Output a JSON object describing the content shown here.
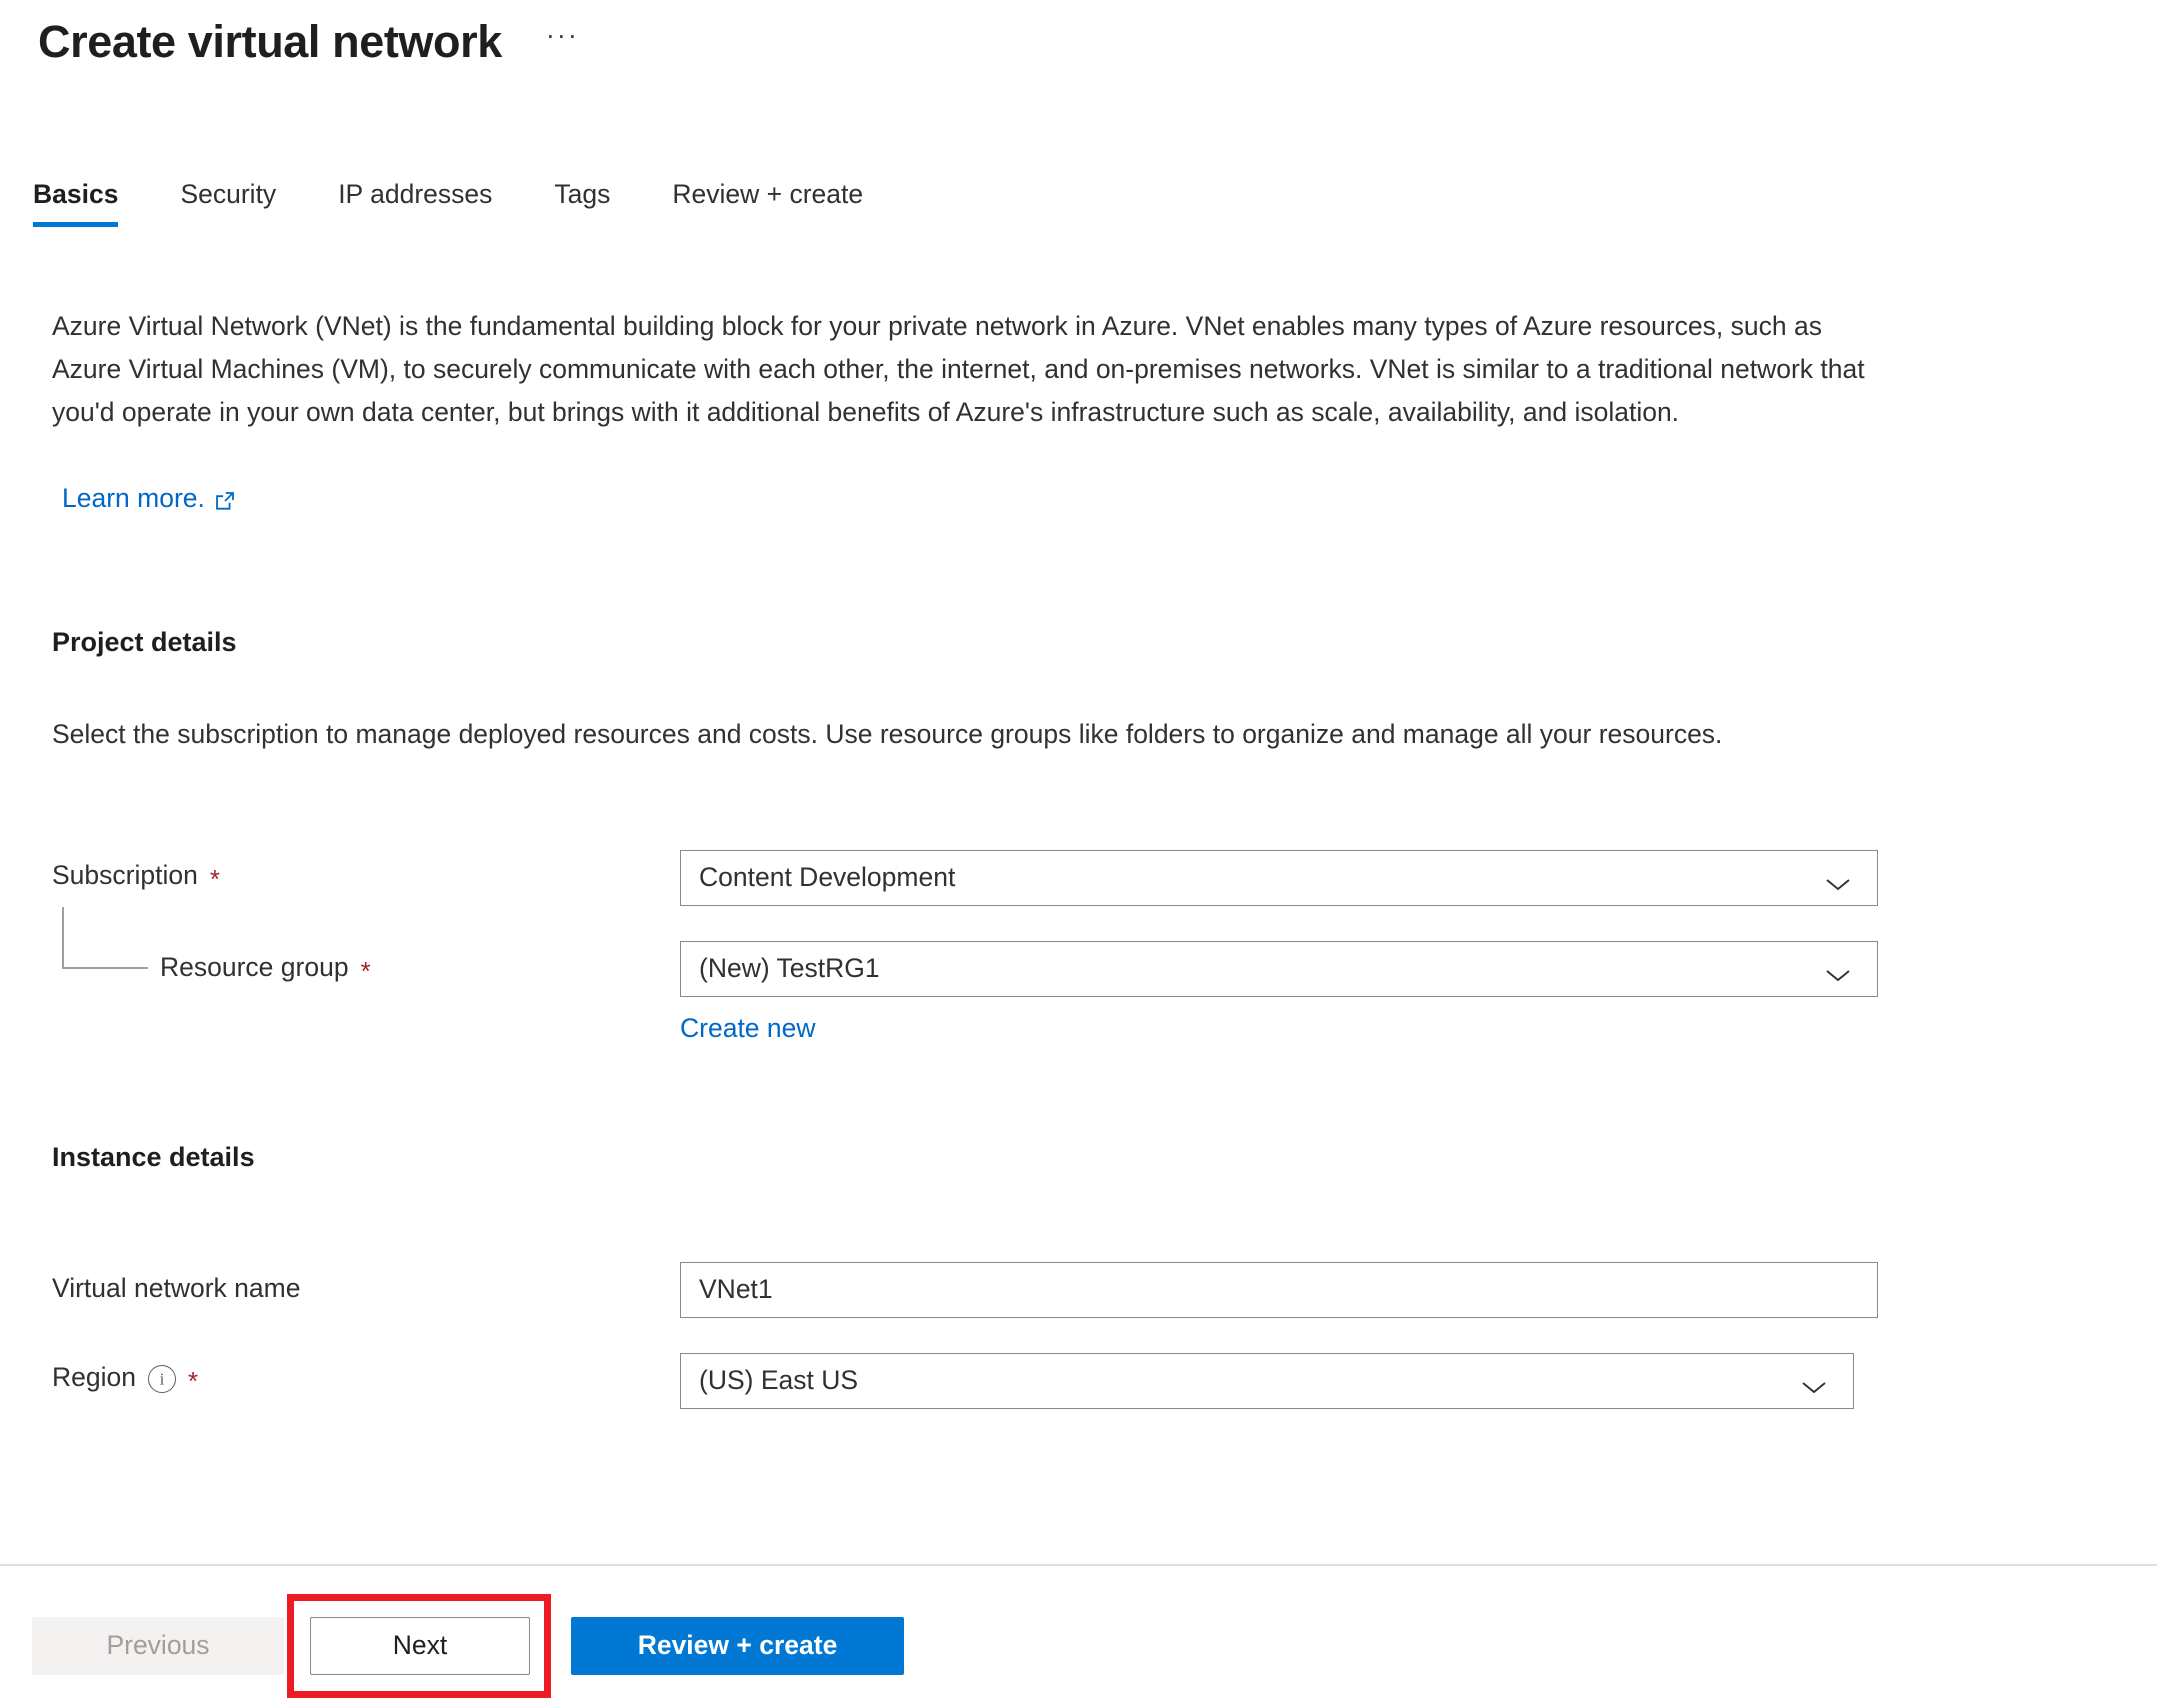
{
  "header": {
    "title": "Create virtual network",
    "more_actions": "···"
  },
  "tabs": [
    {
      "label": "Basics",
      "active": true
    },
    {
      "label": "Security",
      "active": false
    },
    {
      "label": "IP addresses",
      "active": false
    },
    {
      "label": "Tags",
      "active": false
    },
    {
      "label": "Review + create",
      "active": false
    }
  ],
  "intro": {
    "text": "Azure Virtual Network (VNet) is the fundamental building block for your private network in Azure. VNet enables many types of Azure resources, such as Azure Virtual Machines (VM), to securely communicate with each other, the internet, and on-premises networks. VNet is similar to a traditional network that you'd operate in your own data center, but brings with it additional benefits of Azure's infrastructure such as scale, availability, and isolation.",
    "learn_more_label": "Learn more.",
    "learn_more_icon": "external-link-icon"
  },
  "project_details": {
    "heading": "Project details",
    "description": "Select the subscription to manage deployed resources and costs. Use resource groups like folders to organize and manage all your resources.",
    "subscription": {
      "label": "Subscription",
      "required": "*",
      "value": "Content Development"
    },
    "resource_group": {
      "label": "Resource group",
      "required": "*",
      "value": "(New) TestRG1",
      "create_new_label": "Create new"
    }
  },
  "instance_details": {
    "heading": "Instance details",
    "virtual_network_name": {
      "label": "Virtual network name",
      "value": "VNet1",
      "placeholder": ""
    },
    "region": {
      "label": "Region",
      "required": "*",
      "info_icon": "info-icon",
      "value": "(US) East US"
    }
  },
  "footer": {
    "previous_label": "Previous",
    "next_label": "Next",
    "review_create_label": "Review + create"
  },
  "colors": {
    "accent": "#0078d4",
    "link": "#0068c8",
    "required_star": "#a4262c",
    "highlight": "#ed1c24",
    "disabled_text": "#a19f9d",
    "border": "#8a8886"
  }
}
